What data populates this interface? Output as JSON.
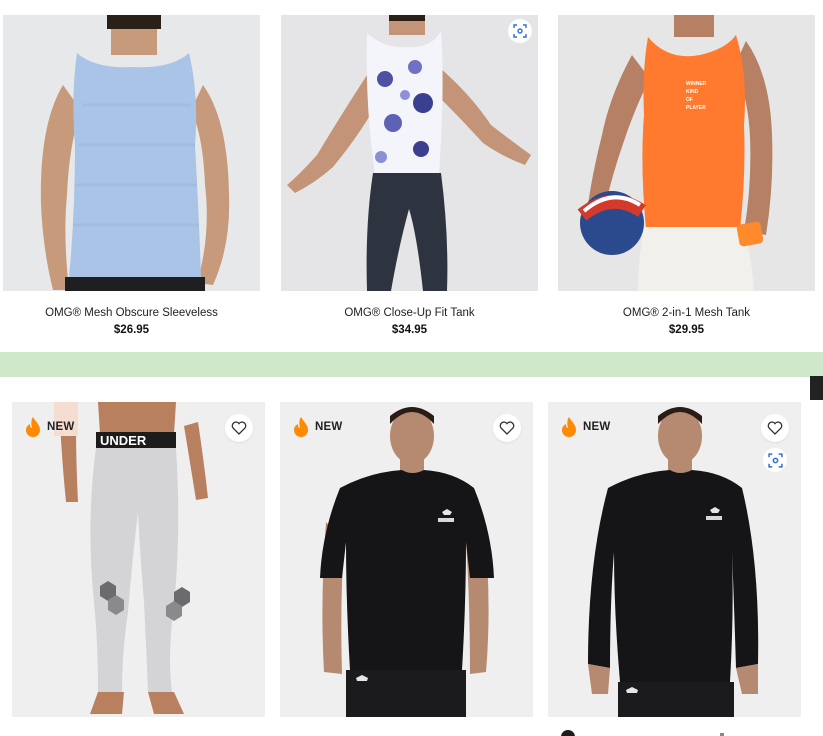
{
  "top_row": {
    "products": [
      {
        "name": "OMG® Mesh Obscure Sleeveless",
        "price": "$26.95",
        "image": "light-blue-sleeveless-tank-model",
        "tank_color": "#a9c4e6"
      },
      {
        "name": "OMG® Close-Up Fit Tank",
        "price": "$34.95",
        "image": "tie-dye-tank-model",
        "tank_color": "#f4f4fb",
        "has_scan_icon": true
      },
      {
        "name": "OMG® 2-in-1 Mesh Tank",
        "price": "$29.95",
        "image": "orange-mesh-tank-basketball-model",
        "tank_color": "#ff7a2e",
        "print_lines": [
          "WINNER",
          "KIND",
          "OF",
          "PLAYER"
        ]
      }
    ]
  },
  "banner": {
    "color": "#cfe8c9"
  },
  "bottom_row": {
    "products": [
      {
        "badge": "NEW",
        "badge_icon": "fire-icon",
        "image": "compression-leggings-model",
        "waistband_text": "UNDER",
        "has_wishlist": true
      },
      {
        "badge": "NEW",
        "badge_icon": "fire-icon",
        "image": "black-short-sleeve-tee-model",
        "has_wishlist": true
      },
      {
        "badge": "NEW",
        "badge_icon": "fire-icon",
        "image": "black-long-sleeve-tee-model",
        "has_wishlist": true,
        "has_scan_icon": true
      }
    ]
  },
  "colors": {
    "accent_fire": "#ff8a00",
    "accent_scan": "#2f6fd6",
    "text": "#1c1c1c"
  }
}
